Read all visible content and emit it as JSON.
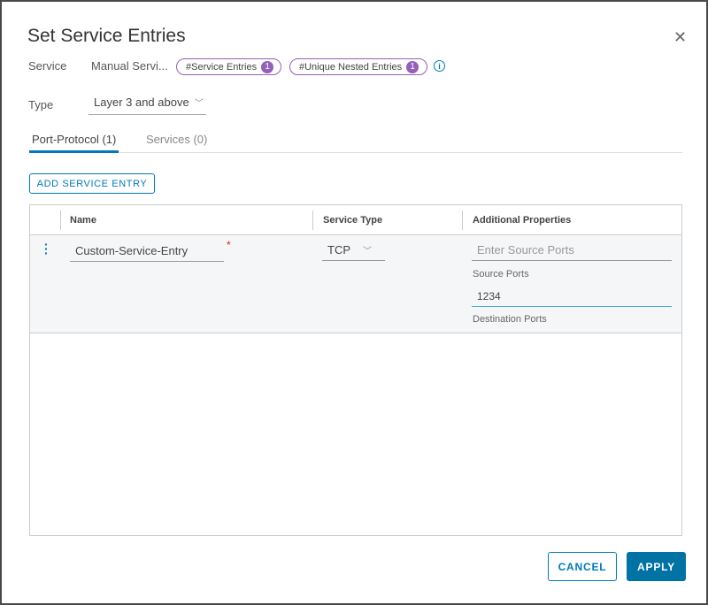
{
  "dialog": {
    "title": "Set Service Entries",
    "close_icon": "close-icon"
  },
  "service": {
    "label": "Service",
    "value": "Manual Servi...",
    "pills": [
      {
        "label": "#Service Entries",
        "count": "1"
      },
      {
        "label": "#Unique Nested Entries",
        "count": "1"
      }
    ],
    "info_icon": "i"
  },
  "type": {
    "label": "Type",
    "selected": "Layer 3 and above"
  },
  "tabs": [
    {
      "label": "Port-Protocol (1)",
      "active": true
    },
    {
      "label": "Services (0)",
      "active": false
    }
  ],
  "add_button": "ADD SERVICE ENTRY",
  "grid": {
    "columns": [
      "Name",
      "Service Type",
      "Additional Properties"
    ],
    "rows": [
      {
        "name": "Custom-Service-Entry",
        "required_marker": "*",
        "service_type": "TCP",
        "source_ports_placeholder": "Enter Source Ports",
        "source_ports_label": "Source Ports",
        "destination_ports_value": "1234",
        "destination_ports_label": "Destination Ports"
      }
    ]
  },
  "footer": {
    "cancel": "CANCEL",
    "apply": "APPLY"
  },
  "colors": {
    "accent": "#0079b8",
    "badge": "#9460b8",
    "apply_bg": "#0072a3"
  }
}
